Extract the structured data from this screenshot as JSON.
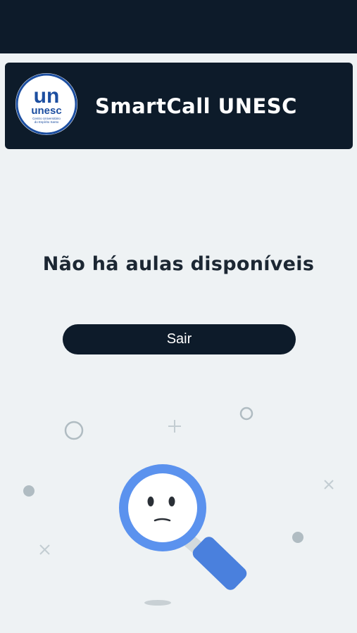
{
  "header": {
    "title": "SmartCall UNESC",
    "logo_icon": "unesc-logo",
    "logo_text": {
      "main": "UN",
      "brand": "unesc",
      "tagline1": "Centro Universitário",
      "tagline2": "do Espírito Santo"
    }
  },
  "main": {
    "empty_message": "Não há aulas disponíveis",
    "exit_button_label": "Sair"
  },
  "illustration": {
    "icon": "sad-magnifying-glass-icon"
  },
  "colors": {
    "dark_navy": "#0d1b2a",
    "background": "#eef2f4",
    "accent_blue": "#5b8fe8",
    "decor_gray": "#b0bcc2"
  }
}
